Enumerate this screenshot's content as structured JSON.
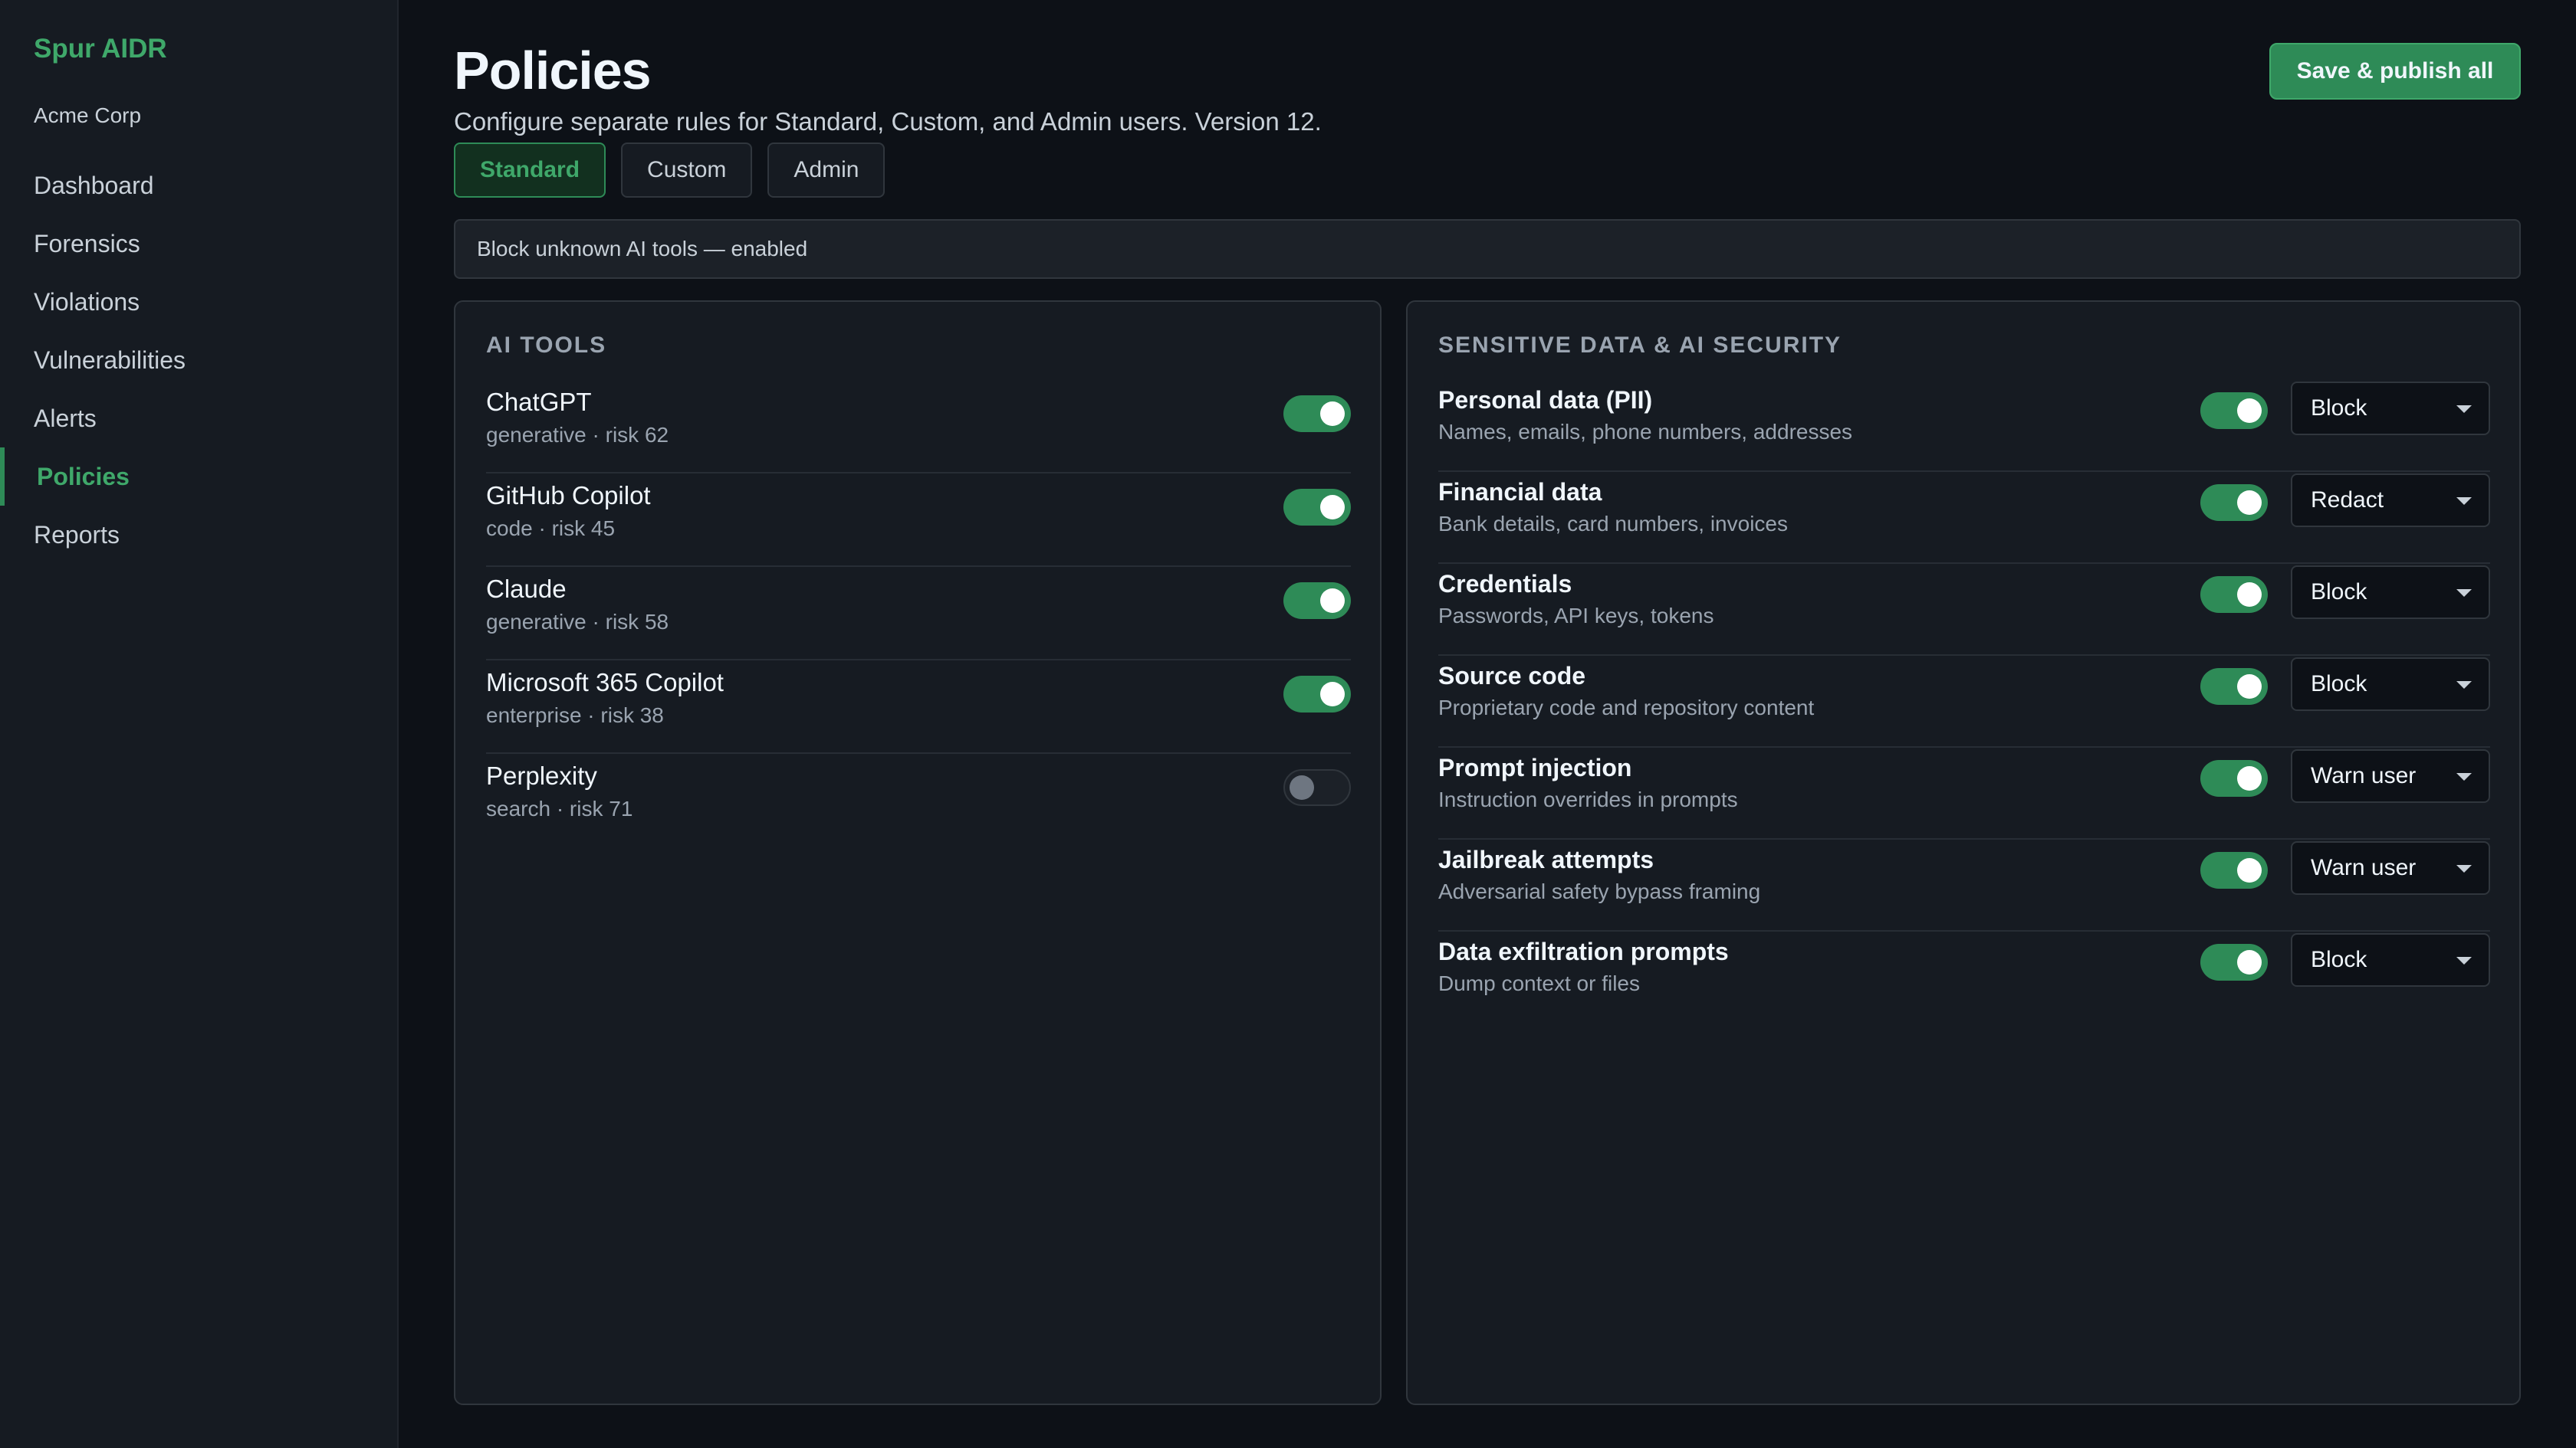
{
  "sidebar": {
    "brand": "Spur AIDR",
    "org": "Acme Corp",
    "items": [
      {
        "label": "Dashboard",
        "active": false
      },
      {
        "label": "Forensics",
        "active": false
      },
      {
        "label": "Violations",
        "active": false
      },
      {
        "label": "Vulnerabilities",
        "active": false
      },
      {
        "label": "Alerts",
        "active": false
      },
      {
        "label": "Policies",
        "active": true
      },
      {
        "label": "Reports",
        "active": false
      }
    ]
  },
  "header": {
    "title": "Policies",
    "subtitle": "Configure separate rules for Standard, Custom, and Admin users. Version 12.",
    "publish_label": "Save & publish all"
  },
  "tabs": [
    {
      "label": "Standard",
      "active": true
    },
    {
      "label": "Custom",
      "active": false
    },
    {
      "label": "Admin",
      "active": false
    }
  ],
  "banner": "Block unknown AI tools — enabled",
  "ai_tools": {
    "heading": "AI TOOLS",
    "items": [
      {
        "name": "ChatGPT",
        "meta": "generative · risk 62",
        "enabled": true
      },
      {
        "name": "GitHub Copilot",
        "meta": "code · risk 45",
        "enabled": true
      },
      {
        "name": "Claude",
        "meta": "generative · risk 58",
        "enabled": true
      },
      {
        "name": "Microsoft 365 Copilot",
        "meta": "enterprise · risk 38",
        "enabled": true
      },
      {
        "name": "Perplexity",
        "meta": "search · risk 71",
        "enabled": false
      }
    ]
  },
  "sensitive": {
    "heading": "SENSITIVE DATA & AI SECURITY",
    "items": [
      {
        "name": "Personal data (PII)",
        "desc": "Names, emails, phone numbers, addresses",
        "enabled": true,
        "action": "Block"
      },
      {
        "name": "Financial data",
        "desc": "Bank details, card numbers, invoices",
        "enabled": true,
        "action": "Redact"
      },
      {
        "name": "Credentials",
        "desc": "Passwords, API keys, tokens",
        "enabled": true,
        "action": "Block"
      },
      {
        "name": "Source code",
        "desc": "Proprietary code and repository content",
        "enabled": true,
        "action": "Block"
      },
      {
        "name": "Prompt injection",
        "desc": "Instruction overrides in prompts",
        "enabled": true,
        "action": "Warn user"
      },
      {
        "name": "Jailbreak attempts",
        "desc": "Adversarial safety bypass framing",
        "enabled": true,
        "action": "Warn user"
      },
      {
        "name": "Data exfiltration prompts",
        "desc": "Dump context or files",
        "enabled": true,
        "action": "Block"
      }
    ]
  },
  "colors": {
    "accent": "#2e8b57",
    "accent_text": "#3fa86a",
    "background": "#0d1117",
    "panel": "#161b22"
  }
}
